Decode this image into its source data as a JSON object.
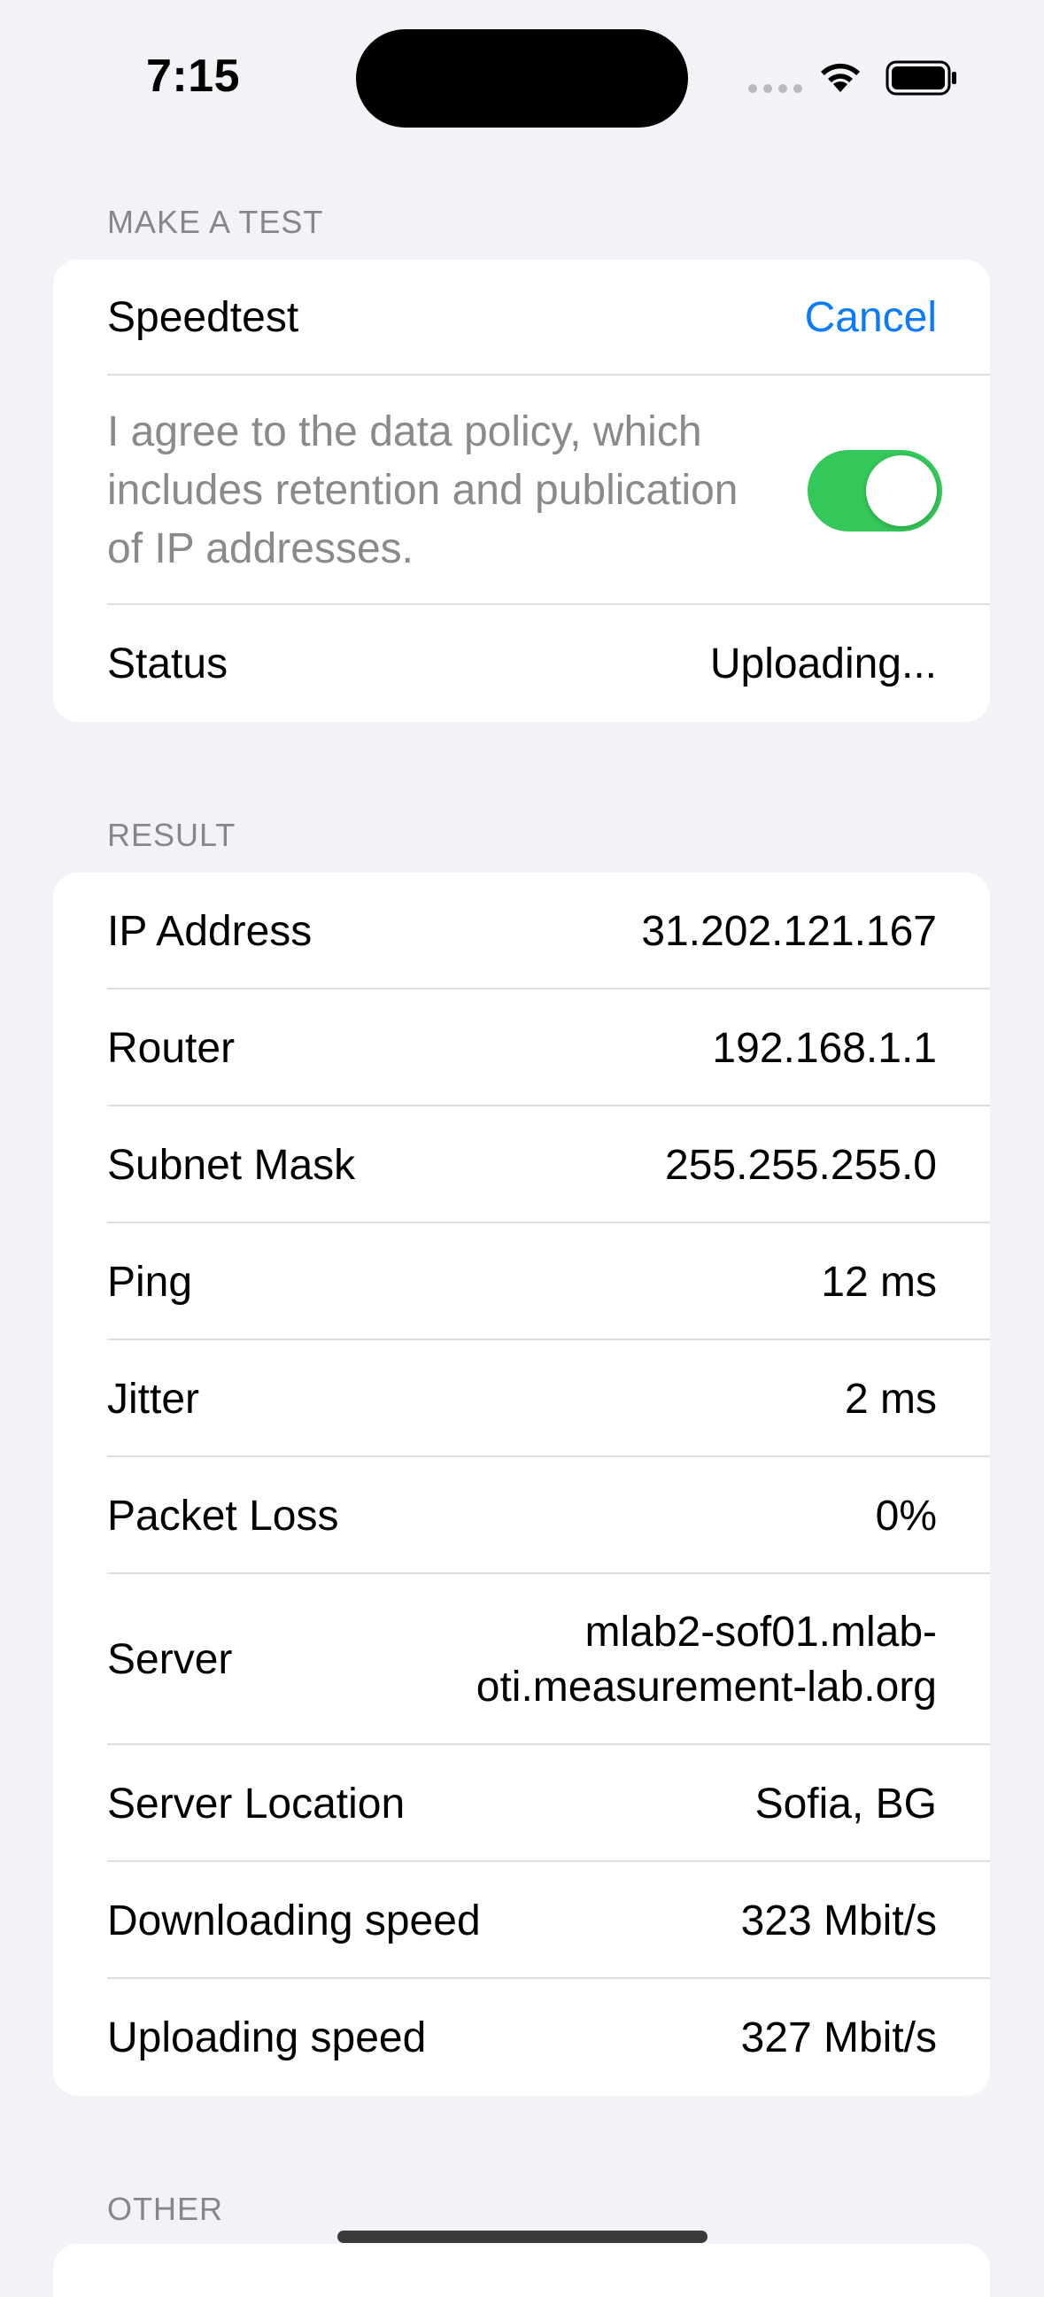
{
  "status_bar": {
    "time": "7:15"
  },
  "sections": {
    "make_test_header": "MAKE A TEST",
    "result_header": "RESULT",
    "other_header": "OTHER"
  },
  "test": {
    "speedtest_label": "Speedtest",
    "cancel_label": "Cancel",
    "policy_text": "I agree to the data policy, which includes retention and publication of IP addresses.",
    "policy_toggle_on": true,
    "status_label": "Status",
    "status_value": "Uploading..."
  },
  "results": [
    {
      "label": "IP Address",
      "value": "31.202.121.167"
    },
    {
      "label": "Router",
      "value": "192.168.1.1"
    },
    {
      "label": "Subnet Mask",
      "value": "255.255.255.0"
    },
    {
      "label": "Ping",
      "value": "12 ms"
    },
    {
      "label": "Jitter",
      "value": "2 ms"
    },
    {
      "label": "Packet Loss",
      "value": "0%"
    },
    {
      "label": "Server",
      "value_line1": "mlab2-sof01.mlab-",
      "value_line2": "oti.measurement-lab.org"
    },
    {
      "label": "Server Location",
      "value": "Sofia, BG"
    },
    {
      "label": "Downloading speed",
      "value": "323 Mbit/s"
    },
    {
      "label": "Uploading speed",
      "value": "327 Mbit/s"
    }
  ],
  "colors": {
    "accent": "#0a7aff",
    "toggle_on": "#34c759",
    "background": "#f2f2f7"
  },
  "icons": [
    "cellular-signal-icon",
    "wifi-icon",
    "battery-icon"
  ]
}
